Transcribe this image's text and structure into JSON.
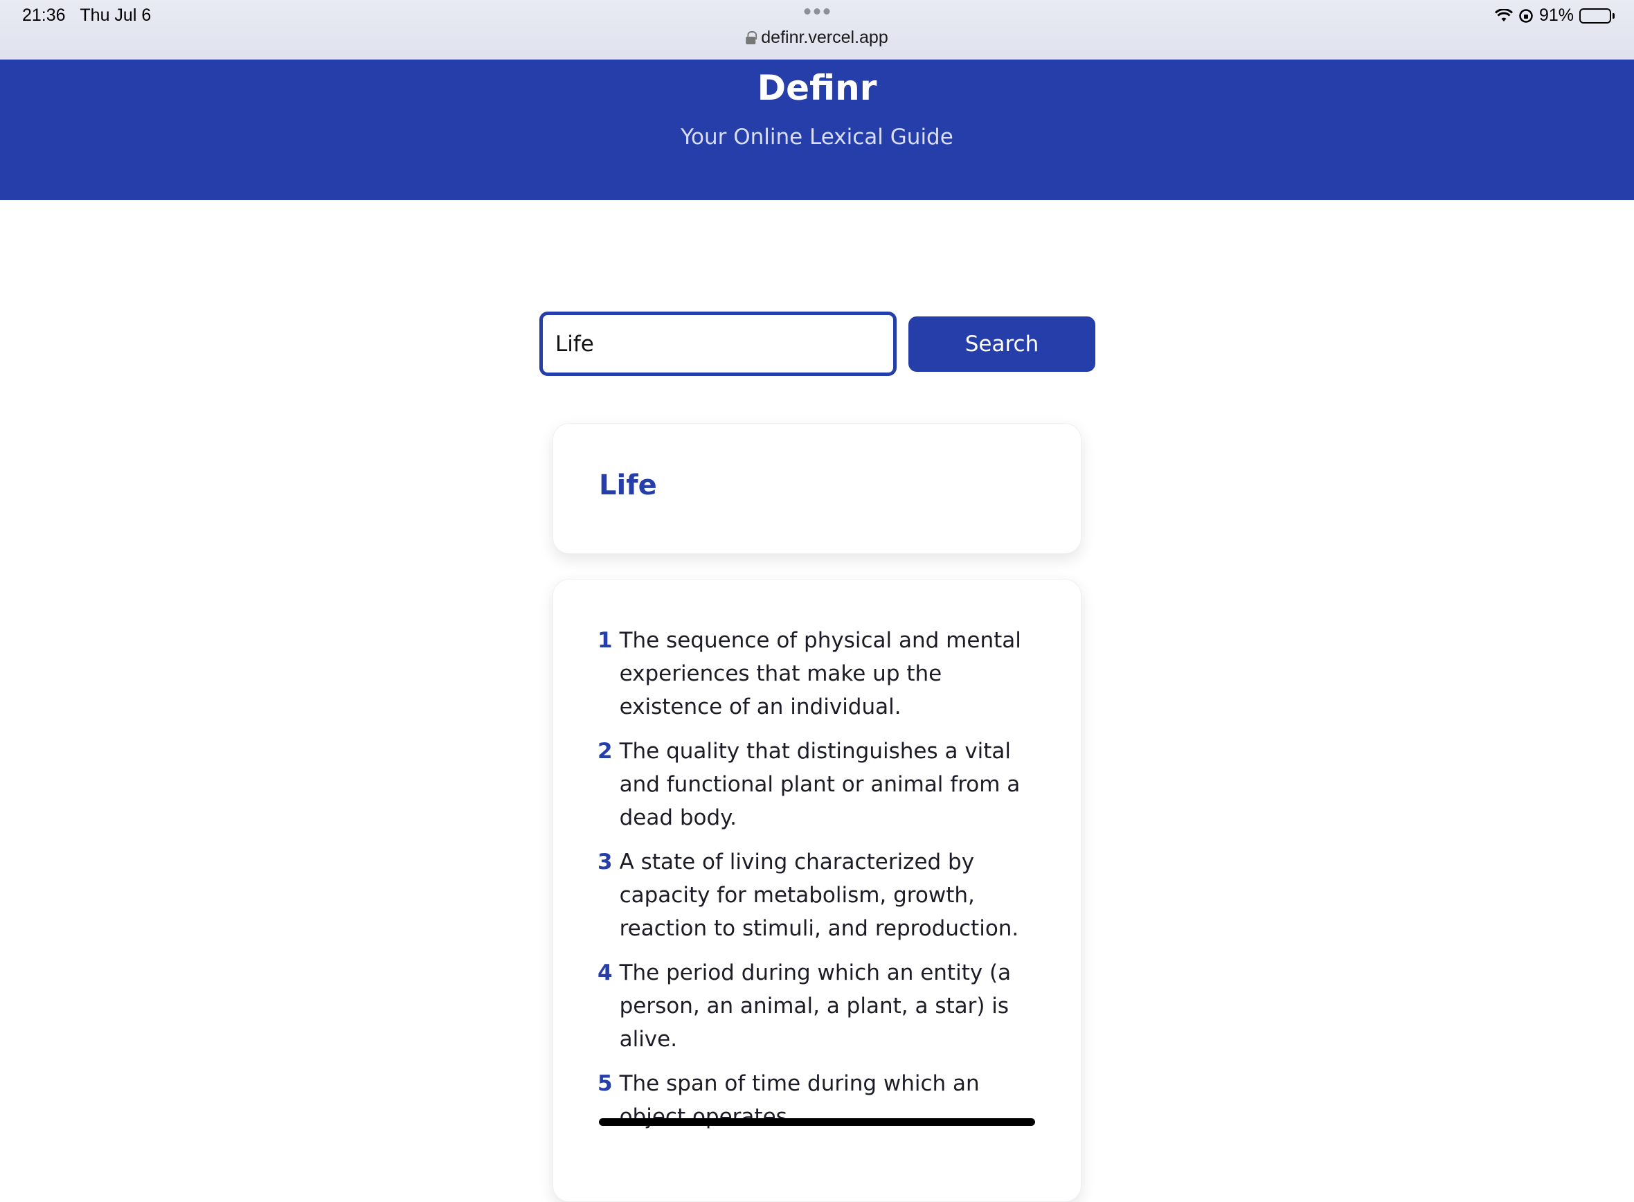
{
  "status_bar": {
    "time": "21:36",
    "date": "Thu Jul 6",
    "url": "definr.vercel.app",
    "battery_percent": "91%",
    "battery_level": 0.91
  },
  "header": {
    "title": "Definr",
    "subtitle": "Your Online Lexical Guide"
  },
  "search": {
    "value": "Life",
    "button_label": "Search"
  },
  "result": {
    "word": "Life",
    "definitions": [
      {
        "number": "1",
        "text": "The sequence of physical and mental experiences that make up the existence of an individual."
      },
      {
        "number": "2",
        "text": "The quality that distinguishes a vital and functional plant or animal from a dead body."
      },
      {
        "number": "3",
        "text": "A state of living characterized by capacity for metabolism, growth, reaction to stimuli, and reproduction."
      },
      {
        "number": "4",
        "text": "The period during which an entity (a person, an animal, a plant, a star) is alive."
      },
      {
        "number": "5",
        "text": "The span of time during which an object operates."
      }
    ]
  },
  "colors": {
    "brand": "#263ea9",
    "text": "#1c1c26"
  }
}
